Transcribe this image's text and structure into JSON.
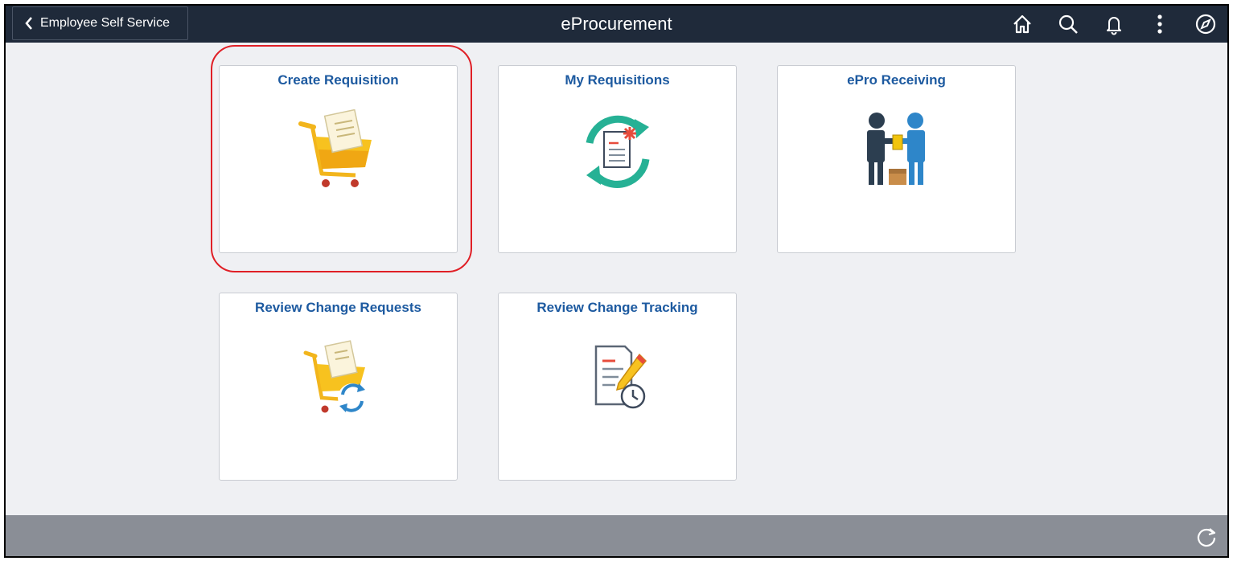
{
  "header": {
    "back_label": "Employee Self Service",
    "title": "eProcurement",
    "icons": [
      "home-icon",
      "search-icon",
      "bell-icon",
      "more-vertical-icon",
      "compass-icon"
    ]
  },
  "tiles": [
    {
      "title": "Create Requisition",
      "icon": "cart-document-icon",
      "highlighted": true
    },
    {
      "title": "My Requisitions",
      "icon": "requisition-refresh-icon"
    },
    {
      "title": "ePro Receiving",
      "icon": "handoff-receiving-icon"
    },
    {
      "title": "Review Change Requests",
      "icon": "cart-change-icon"
    },
    {
      "title": "Review Change Tracking",
      "icon": "document-edit-clock-icon"
    }
  ],
  "footer": {
    "icons": [
      "refresh-icon"
    ]
  },
  "colors": {
    "header_bg": "#1f2a3a",
    "tile_title": "#1d5aa0",
    "highlight": "#e01f26",
    "footer_bg": "#8a8e96"
  }
}
